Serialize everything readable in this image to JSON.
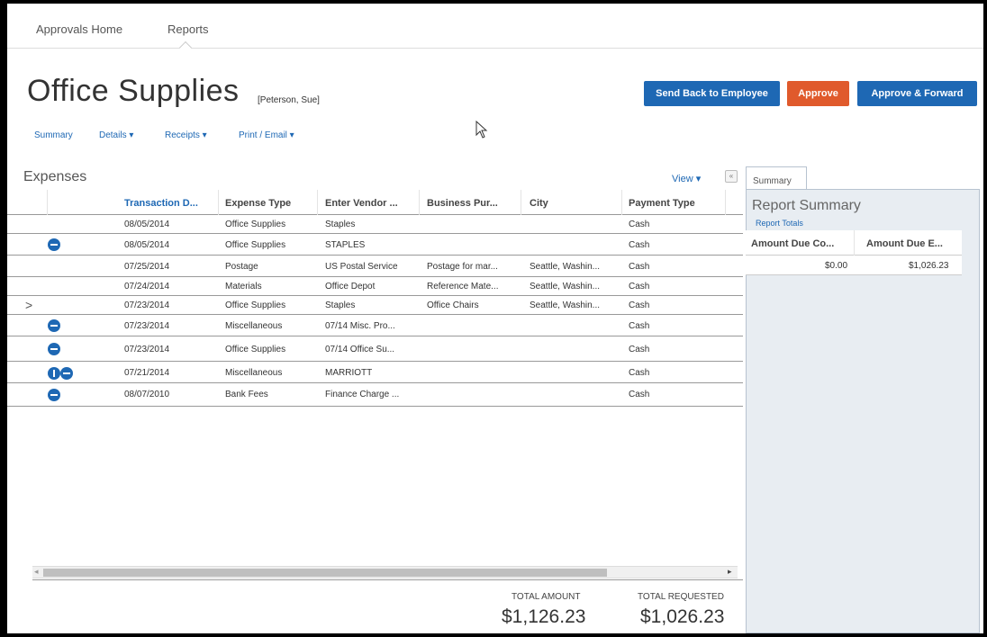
{
  "top_nav": {
    "home": "Approvals Home",
    "reports": "Reports"
  },
  "report": {
    "title": "Office Supplies",
    "employee": "[Peterson, Sue]"
  },
  "actions": {
    "send_back": "Send Back to Employee",
    "approve": "Approve",
    "approve_forward": "Approve & Forward"
  },
  "sub_nav": {
    "summary": "Summary",
    "details": "Details ▾",
    "receipts": "Receipts ▾",
    "print_email": "Print / Email ▾"
  },
  "expenses": {
    "title": "Expenses",
    "view_label": "View ▾",
    "collapse_label": "«",
    "columns": [
      "Transaction D...",
      "Expense Type",
      "Enter Vendor ...",
      "Business Pur...",
      "City",
      "Payment Type"
    ],
    "rows": [
      {
        "icon": "",
        "date": "08/05/2014",
        "type": "Office Supplies",
        "vendor": "Staples",
        "purpose": "",
        "city": "",
        "payment": "Cash"
      },
      {
        "icon": "receipt",
        "date": "08/05/2014",
        "type": "Office Supplies",
        "vendor": "STAPLES",
        "purpose": "",
        "city": "",
        "payment": "Cash"
      },
      {
        "icon": "",
        "date": "07/25/2014",
        "type": "Postage",
        "vendor": "US Postal Service",
        "purpose": "Postage for mar...",
        "city": "Seattle, Washin...",
        "payment": "Cash"
      },
      {
        "icon": "",
        "date": "07/24/2014",
        "type": "Materials",
        "vendor": "Office Depot",
        "purpose": "Reference Mate...",
        "city": "Seattle, Washin...",
        "payment": "Cash"
      },
      {
        "icon": "",
        "date": "07/23/2014",
        "type": "Office Supplies",
        "vendor": "Staples",
        "purpose": "Office Chairs",
        "city": "Seattle, Washin...",
        "payment": "Cash",
        "selected": true
      },
      {
        "icon": "receipt",
        "date": "07/23/2014",
        "type": "Miscellaneous",
        "vendor": "07/14 Misc. Pro...",
        "purpose": "",
        "city": "",
        "payment": "Cash"
      },
      {
        "icon": "receipt",
        "date": "07/23/2014",
        "type": "Office Supplies",
        "vendor": "07/14 Office Su...",
        "purpose": "",
        "city": "",
        "payment": "Cash"
      },
      {
        "icon": "info-receipt",
        "date": "07/21/2014",
        "type": "Miscellaneous",
        "vendor": "MARRIOTT",
        "purpose": "",
        "city": "",
        "payment": "Cash"
      },
      {
        "icon": "receipt",
        "date": "08/07/2010",
        "type": "Bank Fees",
        "vendor": "Finance Charge ...",
        "purpose": "",
        "city": "",
        "payment": "Cash"
      }
    ]
  },
  "totals": {
    "amount_label": "TOTAL AMOUNT",
    "amount_value": "$1,126.23",
    "requested_label": "TOTAL REQUESTED",
    "requested_value": "$1,026.23"
  },
  "summary_panel": {
    "tab": "Summary",
    "title": "Report Summary",
    "link": "Report Totals",
    "columns": [
      "Amount Due Co...",
      "Amount Due E..."
    ],
    "values": [
      "$0.00",
      "$1,026.23"
    ]
  },
  "colors": {
    "accent_blue": "#1e68b4",
    "approve_orange": "#e05a2c"
  }
}
